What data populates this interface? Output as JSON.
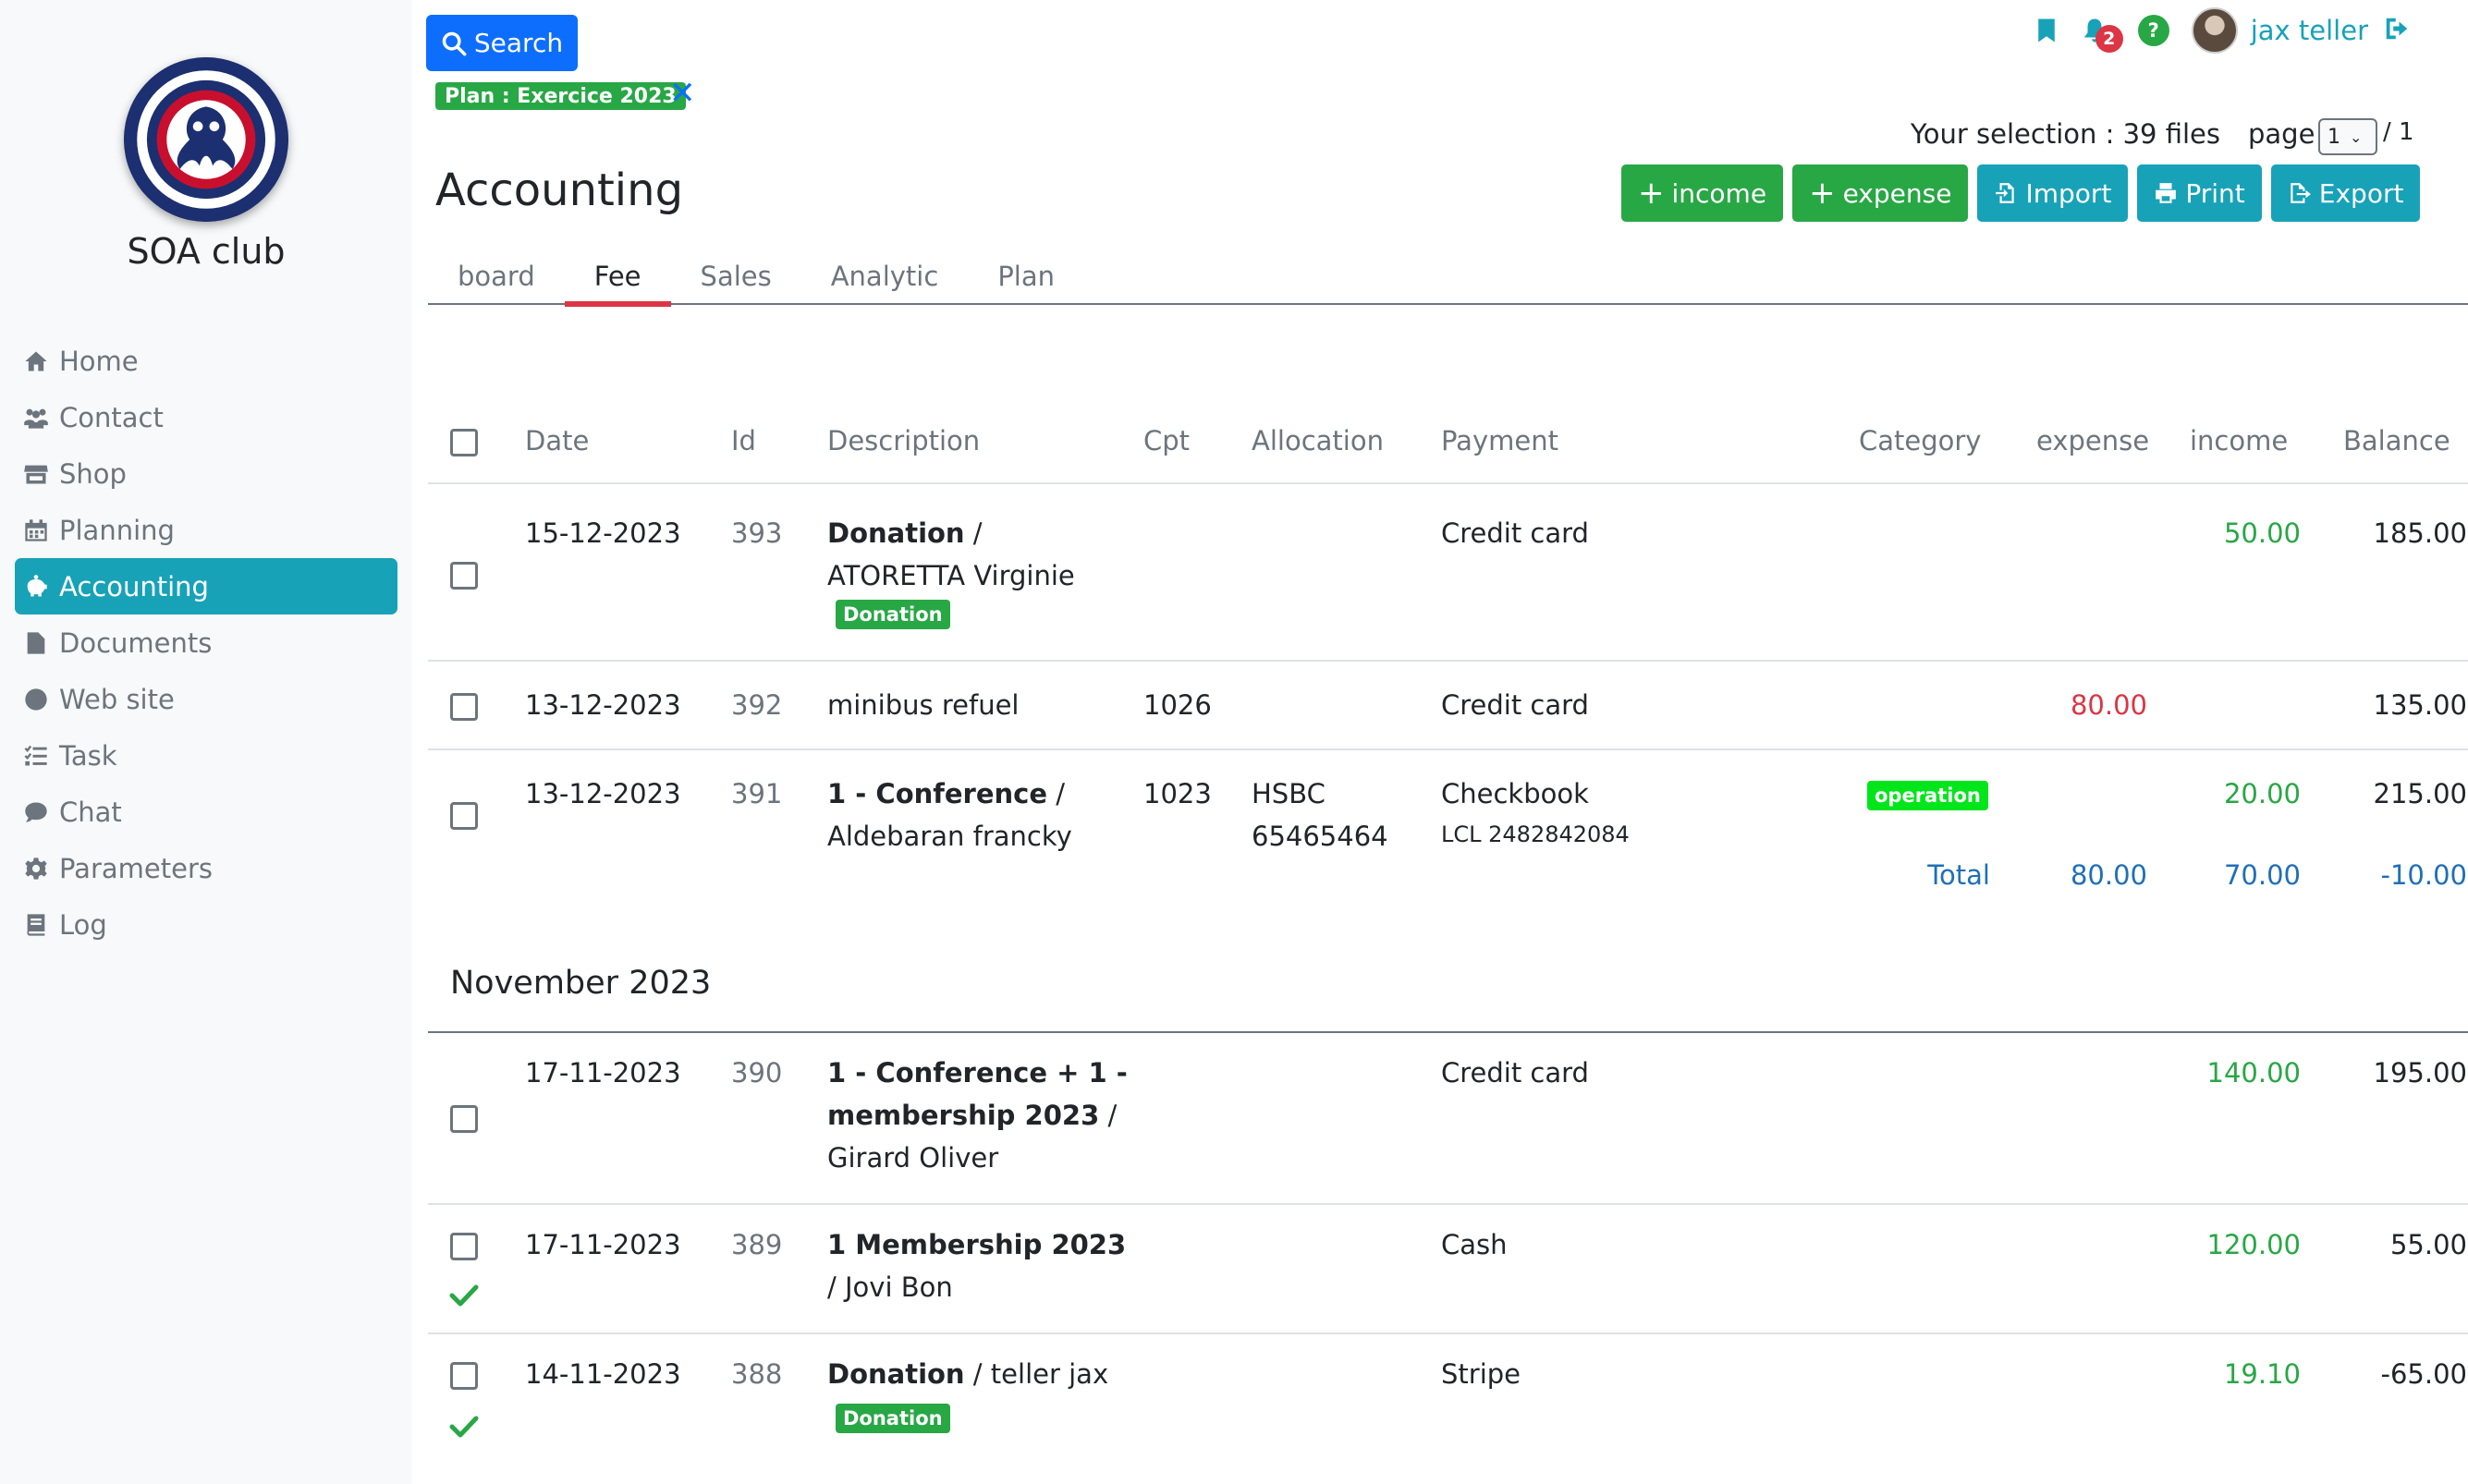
{
  "sidebar": {
    "club_name": "SOA club",
    "items": [
      {
        "label": "Home",
        "icon": "house-icon"
      },
      {
        "label": "Contact",
        "icon": "users-icon"
      },
      {
        "label": "Shop",
        "icon": "store-icon"
      },
      {
        "label": "Planning",
        "icon": "calendar-icon"
      },
      {
        "label": "Accounting",
        "icon": "piggy-bank-icon",
        "active": true
      },
      {
        "label": "Documents",
        "icon": "file-icon"
      },
      {
        "label": "Web site",
        "icon": "globe-icon"
      },
      {
        "label": "Task",
        "icon": "tasks-icon"
      },
      {
        "label": "Chat",
        "icon": "comment-icon"
      },
      {
        "label": "Parameters",
        "icon": "gear-icon"
      },
      {
        "label": "Log",
        "icon": "book-icon"
      }
    ]
  },
  "header": {
    "search_label": "Search",
    "filter_chip": "Plan : Exercice 2023",
    "filter_remove": "✕",
    "notifications_count": "2",
    "help_label": "?",
    "user_name": "jax teller",
    "selection_text": "Your selection : 39 files",
    "page_label": "page",
    "page_value": "1",
    "page_total": "/ 1"
  },
  "page": {
    "title": "Accounting",
    "actions": {
      "income": "income",
      "expense": "expense",
      "import": "Import",
      "print": "Print",
      "export": "Export"
    },
    "tabs": [
      "board",
      "Fee",
      "Sales",
      "Analytic",
      "Plan"
    ],
    "active_tab": "Fee"
  },
  "table": {
    "headers": {
      "date": "Date",
      "id": "Id",
      "description": "Description",
      "cpt": "Cpt",
      "allocation": "Allocation",
      "payment": "Payment",
      "category": "Category",
      "expense": "expense",
      "income": "income",
      "balance": "Balance"
    },
    "december": [
      {
        "date": "15-12-2023",
        "id": "393",
        "desc_bold": "Donation",
        "desc_rest": " / ATORETTA Virginie",
        "tag": "Donation",
        "cpt": "",
        "allocation": "",
        "payment": "Credit card",
        "payment_sub": "",
        "category": "",
        "expense": "",
        "income": "50.00",
        "balance": "185.00"
      },
      {
        "date": "13-12-2023",
        "id": "392",
        "desc_bold": "minibus refuel",
        "desc_rest": "",
        "tag": "",
        "cpt": "1026",
        "allocation": "",
        "payment": "Credit card",
        "payment_sub": "",
        "category": "",
        "expense": "80.00",
        "income": "",
        "balance": "135.00"
      },
      {
        "date": "13-12-2023",
        "id": "391",
        "desc_bold": "1 - Conference",
        "desc_rest": " / Aldebaran francky",
        "tag": "",
        "cpt": "1023",
        "allocation": "HSBC 65465464",
        "payment": "Checkbook",
        "payment_sub": "LCL 2482842084",
        "category": "operation",
        "expense": "",
        "income": "20.00",
        "balance": "215.00"
      }
    ],
    "totals": {
      "label": "Total",
      "expense": "80.00",
      "income": "70.00",
      "balance": "-10.00"
    },
    "month_title": "November 2023",
    "november": [
      {
        "date": "17-11-2023",
        "id": "390",
        "desc_bold": "1 - Conference + 1 - membership 2023",
        "desc_rest": " / Girard Oliver",
        "tag": "",
        "payment": "Credit card",
        "income": "140.00",
        "balance": "195.00",
        "checked": false
      },
      {
        "date": "17-11-2023",
        "id": "389",
        "desc_bold": "1 Membership 2023",
        "desc_rest": " / Jovi Bon",
        "tag": "",
        "payment": "Cash",
        "income": "120.00",
        "balance": "55.00",
        "checked": true
      },
      {
        "date": "14-11-2023",
        "id": "388",
        "desc_bold": "Donation",
        "desc_rest": " / teller jax",
        "tag": "Donation",
        "payment": "Stripe",
        "income": "19.10",
        "balance": "-65.00",
        "checked": true
      }
    ]
  },
  "colors": {
    "accent": "#17a2b8",
    "primary": "#0d6efd",
    "success": "#28a745",
    "danger": "#dc3545",
    "total_blue": "#1f6fb8"
  }
}
